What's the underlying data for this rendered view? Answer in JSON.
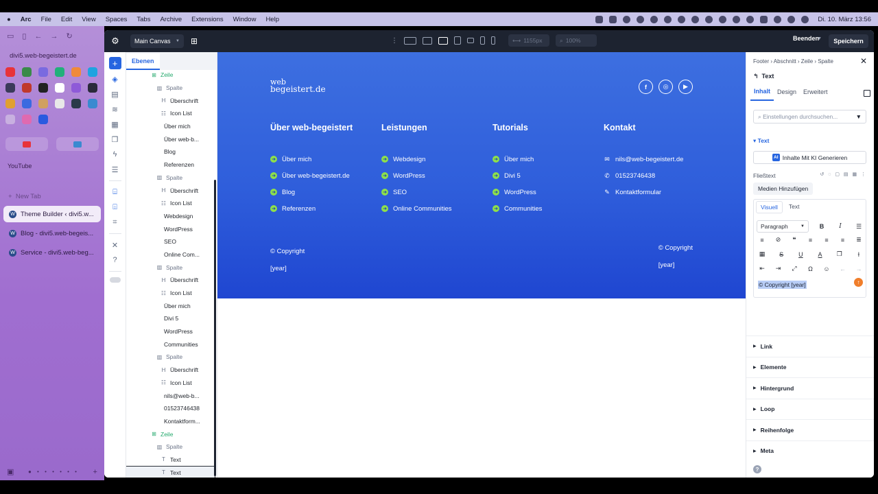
{
  "menubar": {
    "app": "Arc",
    "items": [
      "Arc",
      "File",
      "Edit",
      "View",
      "Spaces",
      "Tabs",
      "Archive",
      "Extensions",
      "Window",
      "Help"
    ],
    "clock": "Di. 10. März  13:56"
  },
  "arc": {
    "url": "divi5.web-begeistert.de",
    "space_label": "YouTube",
    "new_tab": "New Tab",
    "tabs": [
      {
        "title": "Theme Builder ‹ divi5.w..."
      },
      {
        "title": "Blog - divi5.web-begeis..."
      },
      {
        "title": "Service - divi5.web-beg..."
      }
    ]
  },
  "topbar": {
    "canvas_label": "Main Canvas",
    "width_value": "1155px",
    "zoom_value": "100%",
    "exit_label": "Beenden",
    "save_label": "Speichern"
  },
  "layers": {
    "tab_label": "Ebenen",
    "nodes": [
      {
        "label": "Zeile",
        "type": "row",
        "indent": 0
      },
      {
        "label": "Spalte",
        "type": "col",
        "indent": 1
      },
      {
        "label": "Überschrift",
        "type": "heading",
        "indent": 2
      },
      {
        "label": "Icon List",
        "type": "list",
        "indent": 2
      },
      {
        "label": "Über mich",
        "type": "item",
        "indent": 3
      },
      {
        "label": "Über web-b...",
        "type": "item",
        "indent": 3
      },
      {
        "label": "Blog",
        "type": "item",
        "indent": 3
      },
      {
        "label": "Referenzen",
        "type": "item",
        "indent": 3
      },
      {
        "label": "Spalte",
        "type": "col",
        "indent": 1
      },
      {
        "label": "Überschrift",
        "type": "heading",
        "indent": 2
      },
      {
        "label": "Icon List",
        "type": "list",
        "indent": 2
      },
      {
        "label": "Webdesign",
        "type": "item",
        "indent": 3
      },
      {
        "label": "WordPress",
        "type": "item",
        "indent": 3
      },
      {
        "label": "SEO",
        "type": "item",
        "indent": 3
      },
      {
        "label": "Online Com...",
        "type": "item",
        "indent": 3
      },
      {
        "label": "Spalte",
        "type": "col",
        "indent": 1
      },
      {
        "label": "Überschrift",
        "type": "heading",
        "indent": 2
      },
      {
        "label": "Icon List",
        "type": "list",
        "indent": 2
      },
      {
        "label": "Über mich",
        "type": "item",
        "indent": 3
      },
      {
        "label": "Divi 5",
        "type": "item",
        "indent": 3
      },
      {
        "label": "WordPress",
        "type": "item",
        "indent": 3
      },
      {
        "label": "Communities",
        "type": "item",
        "indent": 3
      },
      {
        "label": "Spalte",
        "type": "col",
        "indent": 1
      },
      {
        "label": "Überschrift",
        "type": "heading",
        "indent": 2
      },
      {
        "label": "Icon List",
        "type": "list",
        "indent": 2
      },
      {
        "label": "nils@web-b...",
        "type": "item",
        "indent": 3
      },
      {
        "label": "01523746438",
        "type": "item",
        "indent": 3
      },
      {
        "label": "Kontaktform...",
        "type": "item",
        "indent": 3
      },
      {
        "label": "Zeile",
        "type": "row",
        "indent": 0
      },
      {
        "label": "Spalte",
        "type": "col",
        "indent": 1
      },
      {
        "label": "Text",
        "type": "text",
        "indent": 2
      },
      {
        "label": "Text",
        "type": "text",
        "indent": 2,
        "selected": true
      }
    ]
  },
  "footer": {
    "logo_line1": "web",
    "logo_line2": "begeistert.de",
    "socials": [
      "f",
      "◎",
      "▶"
    ],
    "columns": [
      {
        "title": "Über web-begeistert",
        "items": [
          "Über mich",
          "Über web-begeistert.de",
          "Blog",
          "Referenzen"
        ]
      },
      {
        "title": "Leistungen",
        "items": [
          "Webdesign",
          "WordPress",
          "SEO",
          "Online Communities"
        ]
      },
      {
        "title": "Tutorials",
        "items": [
          "Über mich",
          "Divi 5",
          "WordPress",
          "Communities"
        ]
      }
    ],
    "contact": {
      "title": "Kontakt",
      "email": "nils@web-begeistert.de",
      "phone": "01523746438",
      "form": "Kontaktformular"
    },
    "copyright_left": [
      "© Copyright",
      "[year]"
    ],
    "copyright_right": [
      "© Copyright",
      "[year]"
    ]
  },
  "settings": {
    "breadcrumb": "Footer  ›  Abschnitt  ›  Zeile  ›  Spalte",
    "module_title": "Text",
    "tabs": [
      "Inhalt",
      "Design",
      "Erweitert"
    ],
    "search_placeholder": "Einstellungen durchsuchen...",
    "section_text": "Text",
    "ai_button": "Inhalte Mit KI Generieren",
    "body_label": "Fließtext",
    "media_button": "Medien Hinzufügen",
    "editor_tabs": [
      "Visuell",
      "Text"
    ],
    "paragraph_select": "Paragraph",
    "content": "© Copyright [year]",
    "collapsed_sections": [
      "Link",
      "Elemente",
      "Hintergrund",
      "Loop",
      "Reihenfolge",
      "Meta"
    ]
  },
  "colors": {
    "accent": "#2665e0",
    "footer_top": "#3d6fe0",
    "footer_bottom": "#1f46d1",
    "arrow_green": "#8ee04a",
    "topbar": "#1d2330"
  }
}
